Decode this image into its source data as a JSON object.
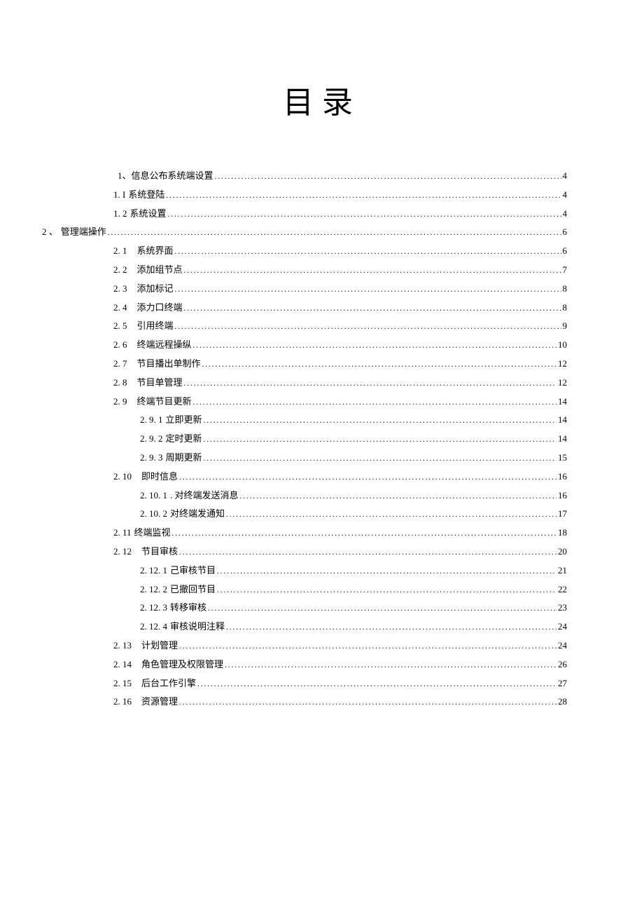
{
  "title": "目录",
  "toc": [
    {
      "level": "level-1",
      "num": "1、",
      "text": "信息公布系统端设置",
      "page": "4",
      "nogap": true
    },
    {
      "level": "level-1b",
      "num": "1. I",
      "text": "系统登陆",
      "page": "4"
    },
    {
      "level": "level-1b",
      "num": "1. 2",
      "text": "系统设置",
      "page": "4"
    },
    {
      "level": "level-0",
      "num": "2 、",
      "text": "管理端操作",
      "page": "6"
    },
    {
      "level": "level-1b",
      "num": "2. 1",
      "text": "系统界面",
      "page": "6",
      "gap": true
    },
    {
      "level": "level-1b",
      "num": "2. 2",
      "text": "添加组节点",
      "page": "7",
      "gap": true
    },
    {
      "level": "level-1b",
      "num": "2. 3",
      "text": "添加标记",
      "page": "8",
      "gap": true
    },
    {
      "level": "level-1b",
      "num": "2. 4",
      "text": "添力口终端",
      "page": "8",
      "gap": true
    },
    {
      "level": "level-1b",
      "num": "2. 5",
      "text": "引用终端",
      "page": "9",
      "gap": true
    },
    {
      "level": "level-1b",
      "num": "2. 6",
      "text": "终端远程操纵",
      "page": "10",
      "gap": true
    },
    {
      "level": "level-1b",
      "num": "2. 7",
      "text": "节目播出单制作",
      "page": "12",
      "gap": true
    },
    {
      "level": "level-1b",
      "num": "2. 8",
      "text": "节目单管理",
      "page": "12",
      "gap": true
    },
    {
      "level": "level-1b",
      "num": "2. 9",
      "text": "终端节目更新",
      "page": "14",
      "gap": true
    },
    {
      "level": "level-2",
      "num": "2. 9. 1",
      "text": "立即更新",
      "page": "14"
    },
    {
      "level": "level-2",
      "num": "2. 9. 2",
      "text": "定时更新",
      "page": "14"
    },
    {
      "level": "level-2",
      "num": "2. 9. 3",
      "text": "周期更新",
      "page": "15"
    },
    {
      "level": "level-1b",
      "num": "2. 10",
      "text": "即时信息",
      "page": "16",
      "gap": true
    },
    {
      "level": "level-2",
      "num": "2. 10. 1",
      "text": ". 对终端发送消息",
      "page": "16"
    },
    {
      "level": "level-2",
      "num": "2. 10. 2",
      "text": "对终端发通知",
      "page": "17"
    },
    {
      "level": "level-1b",
      "num": "2. 11",
      "text": "终端监视",
      "page": "18"
    },
    {
      "level": "level-1b",
      "num": "2. 12",
      "text": "节目审核",
      "page": "20",
      "gap": true
    },
    {
      "level": "level-2",
      "num": "2. 12. 1",
      "text": "己审核节目",
      "page": "21"
    },
    {
      "level": "level-2",
      "num": "2. 12. 2",
      "text": "已撤回节目",
      "page": "22"
    },
    {
      "level": "level-2",
      "num": "2. 12. 3",
      "text": "转移审核",
      "page": "23"
    },
    {
      "level": "level-2",
      "num": "2. 12. 4",
      "text": "审核说明注释",
      "page": "24"
    },
    {
      "level": "level-1b",
      "num": "2. 13",
      "text": "计划管理",
      "page": "24",
      "gap": true
    },
    {
      "level": "level-1b",
      "num": "2. 14",
      "text": "角色管理及权限管理",
      "page": "26",
      "gap": true
    },
    {
      "level": "level-1b",
      "num": "2. 15",
      "text": "后台工作引擎",
      "page": "27",
      "gap": true
    },
    {
      "level": "level-1b",
      "num": "2. 16",
      "text": "资源管理",
      "page": "28",
      "gap": true
    }
  ]
}
